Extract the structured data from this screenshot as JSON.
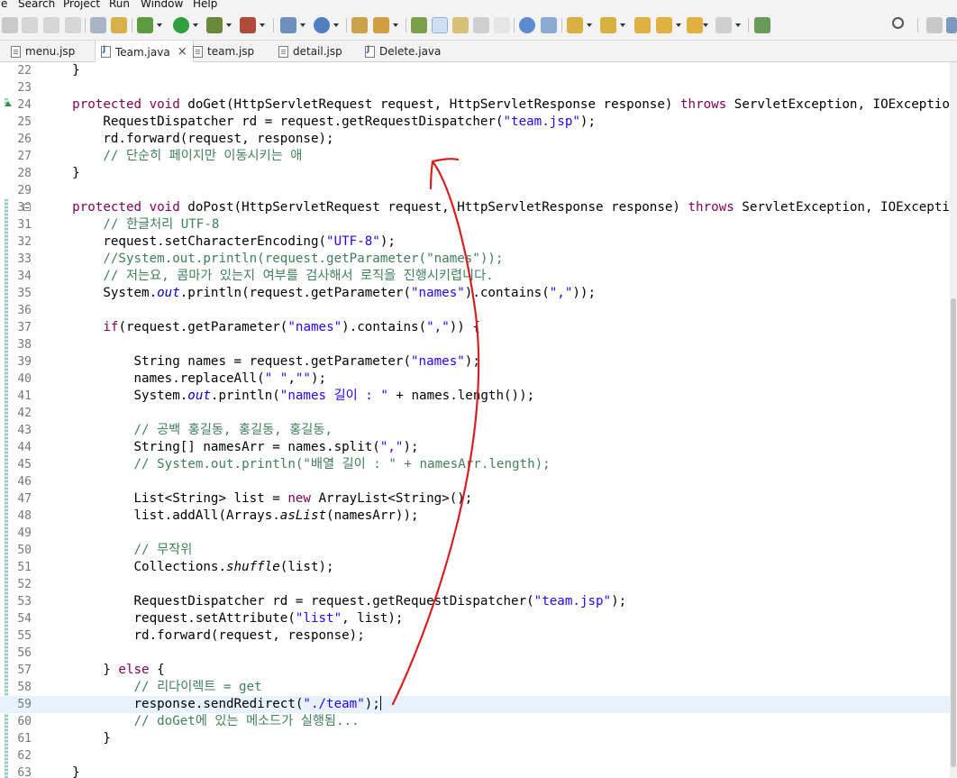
{
  "menu": [
    "e",
    "Search",
    "Project",
    "Run",
    "Window",
    "Help"
  ],
  "tabs": [
    {
      "label": "menu.jsp",
      "icon": "jsp-file-icon",
      "active": false
    },
    {
      "label": "Team.java",
      "icon": "java-file-icon",
      "active": true,
      "close": "×"
    },
    {
      "label": "team.jsp",
      "icon": "jsp-file-icon",
      "active": false
    },
    {
      "label": "detail.jsp",
      "icon": "jsp-file-icon",
      "active": false
    },
    {
      "label": "Delete.java",
      "icon": "java-file-icon",
      "active": false
    }
  ],
  "colors": {
    "keyword": "#7f0055",
    "string": "#2a00ff",
    "comment": "#3f7f5f",
    "field": "#0000c0",
    "annotation": "#d42020"
  },
  "editor": {
    "file": "Team.java",
    "current_line": "59",
    "lines": [
      {
        "n": "22",
        "code": "    }"
      },
      {
        "n": "23",
        "code": ""
      },
      {
        "n": "24",
        "code": "    protected void doGet(HttpServletRequest request, HttpServletResponse response) throws ServletException, IOException {"
      },
      {
        "n": "25",
        "code": "        RequestDispatcher rd = request.getRequestDispatcher(\"team.jsp\");"
      },
      {
        "n": "26",
        "code": "        rd.forward(request, response);"
      },
      {
        "n": "27",
        "code": "        // 단순히 페이지만 이동시키는 애"
      },
      {
        "n": "28",
        "code": "    }"
      },
      {
        "n": "29",
        "code": ""
      },
      {
        "n": "30",
        "code": "    protected void doPost(HttpServletRequest request, HttpServletResponse response) throws ServletException, IOException {"
      },
      {
        "n": "31",
        "code": "        // 한글처리 UTF-8"
      },
      {
        "n": "32",
        "code": "        request.setCharacterEncoding(\"UTF-8\");"
      },
      {
        "n": "33",
        "code": "        //System.out.println(request.getParameter(\"names\"));"
      },
      {
        "n": "34",
        "code": "        // 저는요, 콤마가 있는지 여부를 검사해서 로직을 진행시키렵니다."
      },
      {
        "n": "35",
        "code": "        System.out.println(request.getParameter(\"names\").contains(\",\"));"
      },
      {
        "n": "36",
        "code": ""
      },
      {
        "n": "37",
        "code": "        if(request.getParameter(\"names\").contains(\",\")) {"
      },
      {
        "n": "38",
        "code": ""
      },
      {
        "n": "39",
        "code": "            String names = request.getParameter(\"names\");"
      },
      {
        "n": "40",
        "code": "            names.replaceAll(\" \",\"\");"
      },
      {
        "n": "41",
        "code": "            System.out.println(\"names 길이 : \" + names.length());"
      },
      {
        "n": "42",
        "code": ""
      },
      {
        "n": "43",
        "code": "            // 공백 홍길동, 홍길동, 홍길동,"
      },
      {
        "n": "44",
        "code": "            String[] namesArr = names.split(\",\");"
      },
      {
        "n": "45",
        "code": "            // System.out.println(\"배열 길이 : \" + namesArr.length);"
      },
      {
        "n": "46",
        "code": ""
      },
      {
        "n": "47",
        "code": "            List<String> list = new ArrayList<String>();"
      },
      {
        "n": "48",
        "code": "            list.addAll(Arrays.asList(namesArr));"
      },
      {
        "n": "49",
        "code": ""
      },
      {
        "n": "50",
        "code": "            // 무작위"
      },
      {
        "n": "51",
        "code": "            Collections.shuffle(list);"
      },
      {
        "n": "52",
        "code": ""
      },
      {
        "n": "53",
        "code": "            RequestDispatcher rd = request.getRequestDispatcher(\"team.jsp\");"
      },
      {
        "n": "54",
        "code": "            request.setAttribute(\"list\", list);"
      },
      {
        "n": "55",
        "code": "            rd.forward(request, response);"
      },
      {
        "n": "56",
        "code": ""
      },
      {
        "n": "57",
        "code": "        } else {"
      },
      {
        "n": "58",
        "code": "            // 리다이렉트 = get"
      },
      {
        "n": "59",
        "code": "            response.sendRedirect(\"./team\");"
      },
      {
        "n": "60",
        "code": "            // doGet에 있는 메소드가 실행됨..."
      },
      {
        "n": "61",
        "code": "        }"
      },
      {
        "n": "62",
        "code": ""
      },
      {
        "n": "63",
        "code": "    }"
      }
    ]
  }
}
